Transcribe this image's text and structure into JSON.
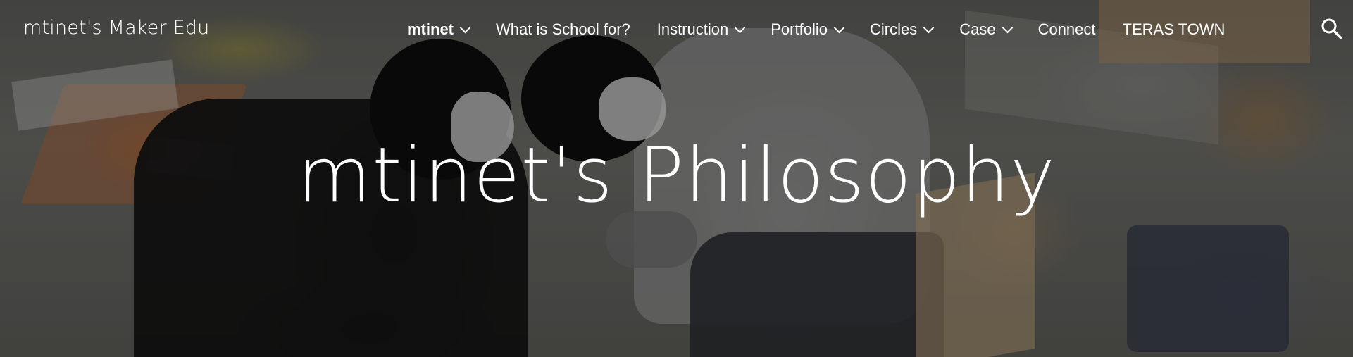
{
  "site": {
    "title": "mtinet's Maker Edu"
  },
  "nav": {
    "items": [
      {
        "label": "mtinet",
        "has_dropdown": true,
        "active": true
      },
      {
        "label": "What is School for?",
        "has_dropdown": false,
        "active": false
      },
      {
        "label": "Instruction",
        "has_dropdown": true,
        "active": false
      },
      {
        "label": "Portfolio",
        "has_dropdown": true,
        "active": false
      },
      {
        "label": "Circles",
        "has_dropdown": true,
        "active": false
      },
      {
        "label": "Case",
        "has_dropdown": true,
        "active": false
      },
      {
        "label": "Connect",
        "has_dropdown": false,
        "active": false
      },
      {
        "label": "TERAS TOWN",
        "has_dropdown": false,
        "active": false
      }
    ],
    "search_icon": "search-icon"
  },
  "hero": {
    "title": "mtinet's Philosophy"
  },
  "colors": {
    "text": "#ffffff",
    "overlay": "#000000"
  }
}
